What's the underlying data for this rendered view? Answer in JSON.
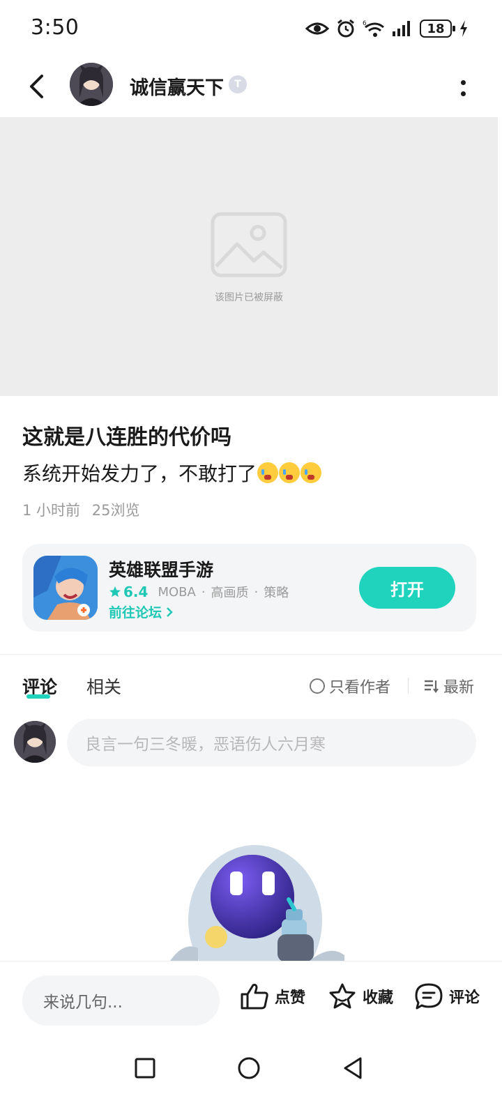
{
  "status_bar": {
    "time": "3:50",
    "battery": "18",
    "icons": [
      "eye-icon",
      "alarm-icon",
      "wifi-icon",
      "signal-icon",
      "battery-icon",
      "charging-icon"
    ]
  },
  "header": {
    "author_name": "诚信赢天下",
    "badge": "T",
    "icons": [
      "back-icon",
      "more-icon"
    ]
  },
  "blocked_image": {
    "text": "该图片已被屏蔽"
  },
  "post": {
    "title": "这就是八连胜的代价吗",
    "body": "系统开始发力了，不敢打了",
    "emoji_count": 3,
    "time": "1 小时前",
    "views": "25浏览"
  },
  "game_card": {
    "name": "英雄联盟手游",
    "rating": "6.4",
    "tags": [
      "MOBA",
      "高画质",
      "策略"
    ],
    "forum_link": "前往论坛",
    "open_label": "打开"
  },
  "comments": {
    "tabs": [
      {
        "label": "评论",
        "active": true
      },
      {
        "label": "相关",
        "active": false
      }
    ],
    "author_only": "只看作者",
    "sort": "最新",
    "placeholder": "良言一句三冬暖，恶语伤人六月寒"
  },
  "bottom_bar": {
    "reply_placeholder": "来说几句...",
    "like": "点赞",
    "favorite": "收藏",
    "comment": "评论"
  },
  "colors": {
    "accent": "#1fd3bd",
    "accent_text": "#1fc8b5",
    "muted": "#9a9a9a",
    "card_bg": "#f4f5f7",
    "blocked_bg": "#ededed"
  }
}
